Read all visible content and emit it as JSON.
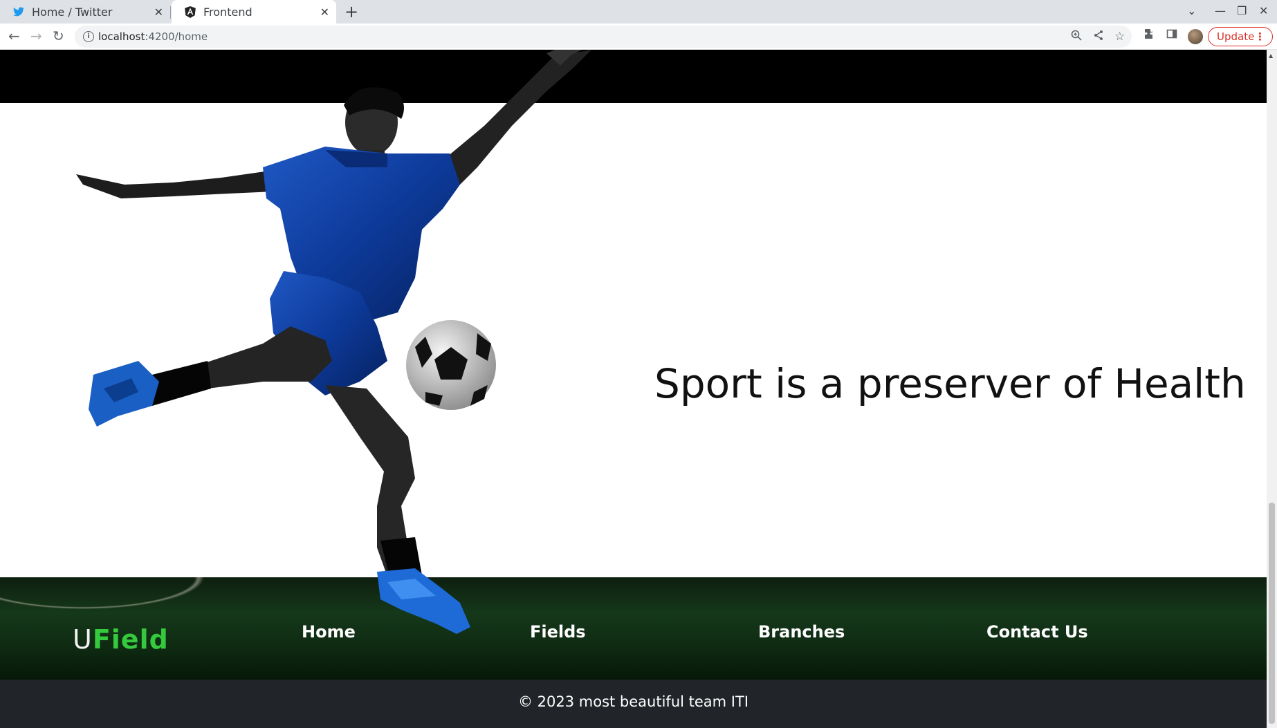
{
  "browser": {
    "tabs": [
      {
        "title": "Home / Twitter",
        "icon": "twitter-bird-icon",
        "active": false
      },
      {
        "title": "Frontend",
        "icon": "angular-icon",
        "active": true
      }
    ],
    "url_host": "localhost",
    "url_path": ":4200/home",
    "update_label": "Update"
  },
  "page": {
    "quote": "Sport is a preserver of Health",
    "footer": {
      "logo_u": "U",
      "logo_rest": "Field",
      "nav": [
        "Home",
        "Fields",
        "Branches",
        "Contact Us"
      ]
    },
    "copyright": "© 2023 most beautiful team ITI"
  },
  "colors": {
    "logo_green": "#35c93d",
    "bottom_bar": "#212529",
    "update_red": "#d93025"
  }
}
